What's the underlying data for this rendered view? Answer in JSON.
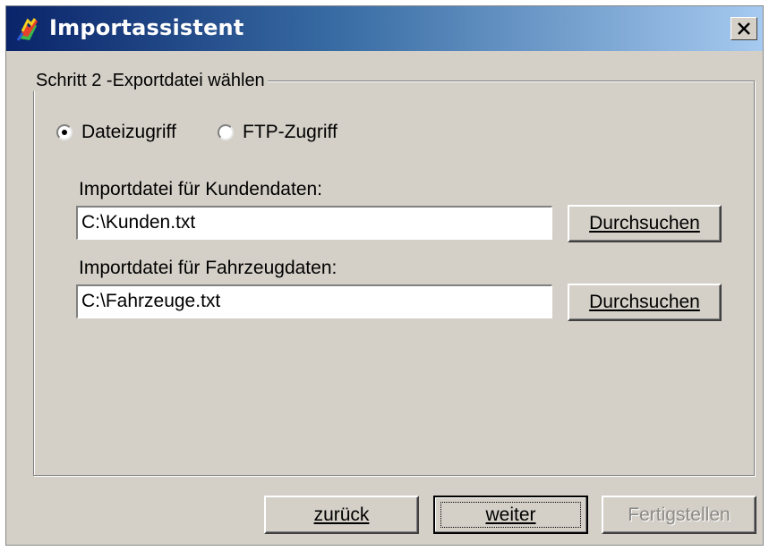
{
  "window": {
    "title": "Importassistent",
    "app_icon": "import-wizard-icon",
    "close_icon": "close-icon"
  },
  "step": {
    "legend": "Schritt 2 -Exportdatei wählen"
  },
  "access_mode": {
    "options": [
      {
        "label": "Dateizugriff",
        "selected": true
      },
      {
        "label": "FTP-Zugriff",
        "selected": false
      }
    ]
  },
  "customer_file": {
    "label": "Importdatei für Kundendaten:",
    "value": "C:\\Kunden.txt",
    "browse_label": "Durchsuchen"
  },
  "vehicle_file": {
    "label": "Importdatei für Fahrzeugdaten:",
    "value": "C:\\Fahrzeuge.txt",
    "browse_label": "Durchsuchen"
  },
  "footer": {
    "back_label": "zurück",
    "next_label": "weiter",
    "finish_label": "Fertigstellen"
  },
  "colors": {
    "titlebar_start": "#0a246a",
    "titlebar_end": "#a6caf0",
    "dialog_bg": "#d4d0c8"
  }
}
